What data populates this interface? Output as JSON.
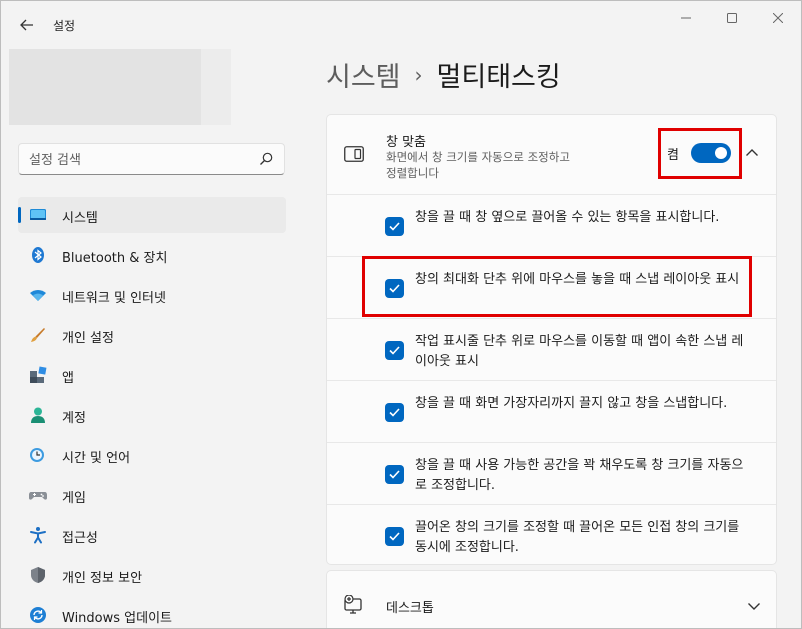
{
  "window": {
    "title": "설정"
  },
  "search": {
    "placeholder": "설정 검색"
  },
  "sidebar": {
    "items": [
      {
        "label": "시스템",
        "icon": "system-monitor-icon",
        "active": true
      },
      {
        "label": "Bluetooth & 장치",
        "icon": "bluetooth-icon"
      },
      {
        "label": "네트워크 및 인터넷",
        "icon": "wifi-icon"
      },
      {
        "label": "개인 설정",
        "icon": "paintbrush-icon"
      },
      {
        "label": "앱",
        "icon": "apps-icon"
      },
      {
        "label": "계정",
        "icon": "account-icon"
      },
      {
        "label": "시간 및 언어",
        "icon": "time-language-icon"
      },
      {
        "label": "게임",
        "icon": "gamepad-icon"
      },
      {
        "label": "접근성",
        "icon": "accessibility-icon"
      },
      {
        "label": "개인 정보 보안",
        "icon": "shield-icon"
      },
      {
        "label": "Windows 업데이트",
        "icon": "update-icon"
      }
    ]
  },
  "breadcrumb": {
    "parent": "시스템",
    "separator": "›",
    "current": "멀티태스킹"
  },
  "snap": {
    "title": "창 맞춤",
    "description": "화면에서 창 크기를 자동으로 조정하고 정렬합니다",
    "toggle_label": "켬",
    "toggle_on": true,
    "options": [
      {
        "text": "창을 끌 때 창 옆으로 끌어올 수 있는 항목을 표시합니다.",
        "checked": true
      },
      {
        "text": "창의 최대화 단추 위에 마우스를 놓을 때 스냅 레이아웃 표시",
        "checked": true
      },
      {
        "text": "작업 표시줄 단추 위로 마우스를 이동할 때 앱이 속한 스냅 레이아웃 표시",
        "checked": true
      },
      {
        "text": "창을 끌 때 화면 가장자리까지 끌지 않고 창을 스냅합니다.",
        "checked": true
      },
      {
        "text": "창을 끌 때 사용 가능한 공간을 꽉 채우도록 창 크기를 자동으로 조정합니다.",
        "checked": true
      },
      {
        "text": "끌어온 창의 크기를 조정할 때 끌어온 모든 인접 창의 크기를 동시에 조정합니다.",
        "checked": true
      }
    ]
  },
  "desktops": {
    "label": "데스크톱"
  },
  "colors": {
    "accent": "#0067c0",
    "highlight": "#e00000"
  }
}
